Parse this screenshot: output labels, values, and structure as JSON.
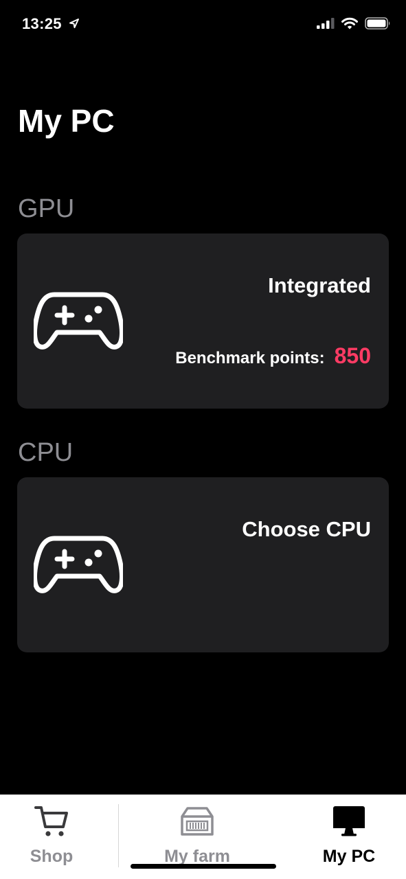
{
  "status_bar": {
    "time": "13:25"
  },
  "page": {
    "title": "My PC"
  },
  "gpu": {
    "section_label": "GPU",
    "card_title": "Integrated",
    "benchmark_label": "Benchmark points:",
    "benchmark_value": "850",
    "icon": "gamepad-icon"
  },
  "cpu": {
    "section_label": "CPU",
    "card_title": "Choose CPU",
    "icon": "gamepad-icon"
  },
  "tab_bar": {
    "active": "My PC",
    "tabs": [
      {
        "label": "Shop",
        "icon": "cart-icon"
      },
      {
        "label": "My farm",
        "icon": "mining-rig-icon"
      },
      {
        "label": "My PC",
        "icon": "monitor-icon"
      }
    ]
  },
  "colors": {
    "background": "#000000",
    "card": "#1f1f21",
    "section_label": "#8e8e93",
    "accent": "#ff3b64",
    "tab_bar": "#ffffff"
  }
}
